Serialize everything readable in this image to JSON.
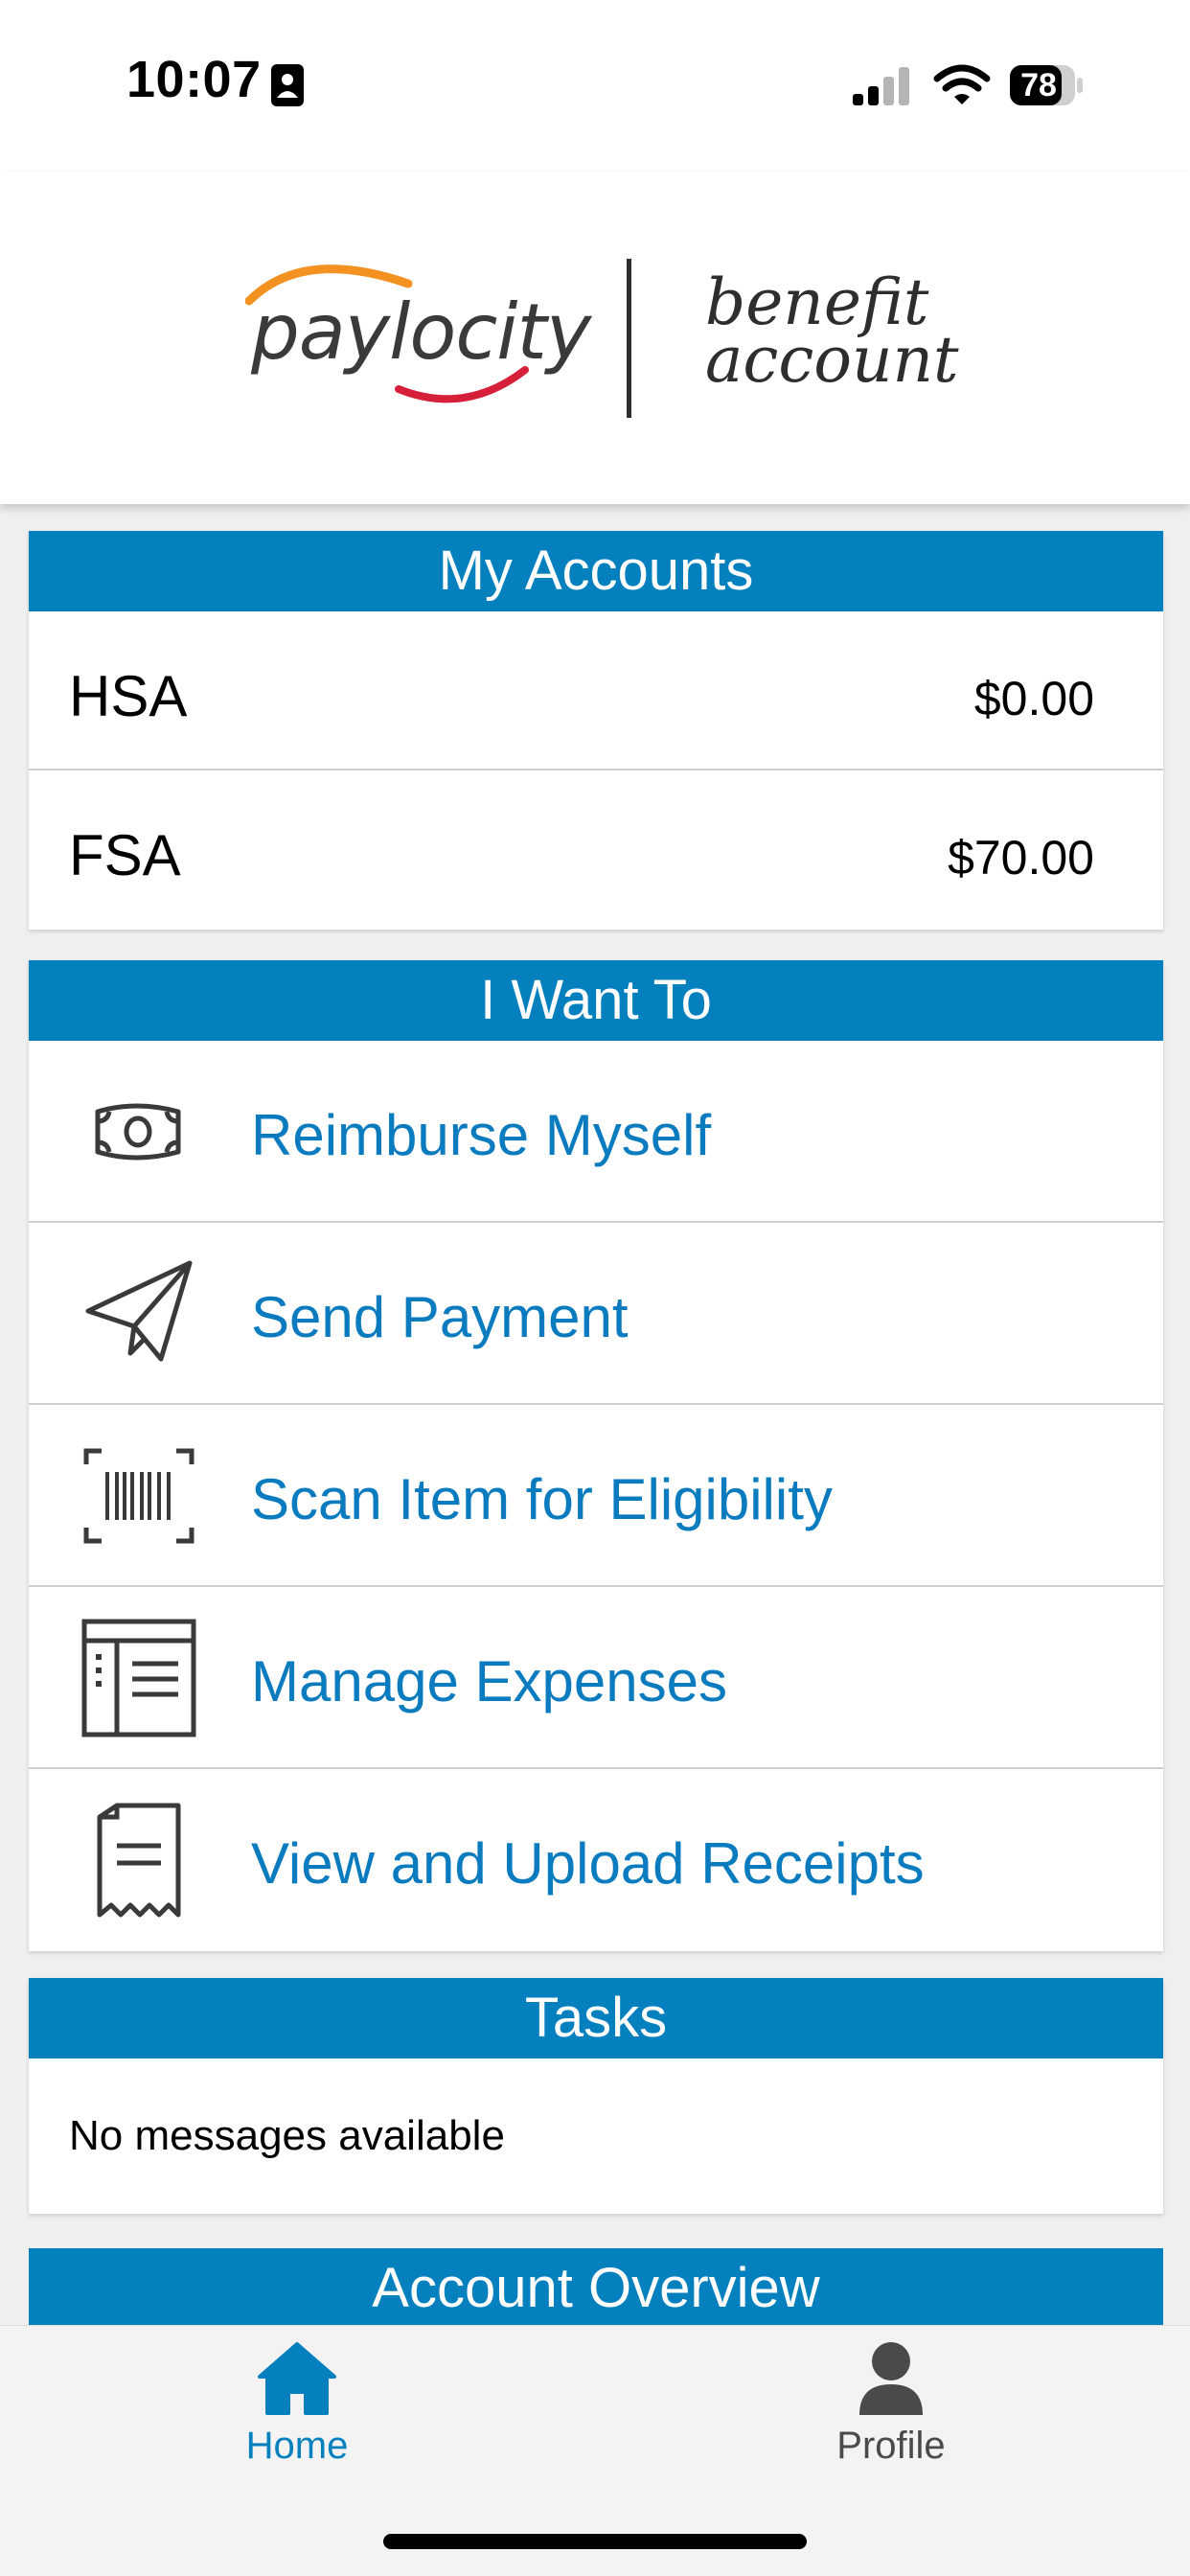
{
  "status_bar": {
    "time": "10:07",
    "battery": "78",
    "icons": [
      "contact-card-icon",
      "cellular-signal-icon",
      "wifi-icon",
      "battery-icon"
    ]
  },
  "header": {
    "logo_brand": "paylocity",
    "logo_product_line1": "benefit",
    "logo_product_line2": "account",
    "colors": {
      "swoosh_orange": "#f39220",
      "swoosh_red": "#d6203a"
    }
  },
  "my_accounts": {
    "title": "My Accounts",
    "accounts": [
      {
        "name": "HSA",
        "amount": "$0.00"
      },
      {
        "name": "FSA",
        "amount": "$70.00"
      }
    ]
  },
  "i_want_to": {
    "title": "I Want To",
    "actions": [
      {
        "label": "Reimburse Myself",
        "icon": "money-bill-icon"
      },
      {
        "label": "Send Payment",
        "icon": "paper-plane-icon"
      },
      {
        "label": "Scan Item for Eligibility",
        "icon": "barcode-scan-icon"
      },
      {
        "label": "Manage Expenses",
        "icon": "expense-list-icon"
      },
      {
        "label": "View and Upload Receipts",
        "icon": "receipt-icon"
      }
    ]
  },
  "tasks": {
    "title": "Tasks",
    "message": "No messages available"
  },
  "account_overview": {
    "title": "Account Overview"
  },
  "bottom_nav": {
    "items": [
      {
        "label": "Home",
        "icon": "home-icon",
        "active": true
      },
      {
        "label": "Profile",
        "icon": "profile-icon",
        "active": false
      }
    ]
  },
  "colors": {
    "accent": "#0580be",
    "link": "#0a7bbf",
    "inactive": "#4a4a4a"
  }
}
